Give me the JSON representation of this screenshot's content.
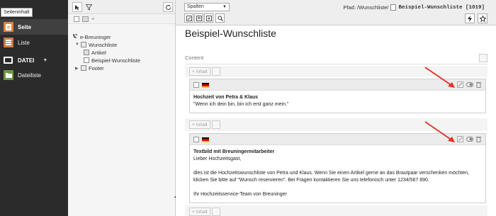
{
  "modmenu": {
    "tooltip": "Seiteninhalt",
    "items": [
      {
        "label": "Seite",
        "color": "#e5823a",
        "active": true
      },
      {
        "label": "Liste",
        "color": "#d17b3e",
        "active": false
      }
    ],
    "group": {
      "label": "DATEI"
    },
    "file_items": [
      {
        "label": "Dateiliste",
        "color": "#6c9b3b"
      }
    ]
  },
  "tree": {
    "root": "e-Breuninger",
    "nodes": [
      {
        "label": "Wunschliste"
      },
      {
        "label": "Artikel"
      },
      {
        "label": "Beispiel-Wunschliste"
      },
      {
        "label": "Footer"
      }
    ]
  },
  "docheader": {
    "select_value": "Spalten",
    "path_label": "Pfad: /Wunschliste/",
    "page_title": "Beispiel-Wunschliste [1019]"
  },
  "main": {
    "title": "Beispiel-Wunschliste",
    "column_label": "Content",
    "new_content_label": "Inhalt",
    "elements": [
      {
        "header": "Hochzeit von Petra & Klaus",
        "lines": [
          "\"Wenn ich dein bin, bin ich erst ganz mein.\""
        ]
      },
      {
        "header": "Textbild mit Breuningermitarbeiter",
        "lines": [
          "Lieber Hochzeitsgast,",
          "",
          "dies ist die Hochzeitswunschliste von Petra und Klaus. Wenn Sie einen Artikel gerne an das Brautpaar verschenken möchten,",
          "klicken Sie bitte auf \"Wunsch reservieren\". Bei Fragen kontaktieren Sie uns telefonisch unter 1234/567 890.",
          "",
          "Ihr Hochzeitsservice-Team von Breuninger"
        ]
      }
    ]
  },
  "colors": {
    "module_bg": "#2b2b2b",
    "annotation_arrow": "#e2302a"
  }
}
